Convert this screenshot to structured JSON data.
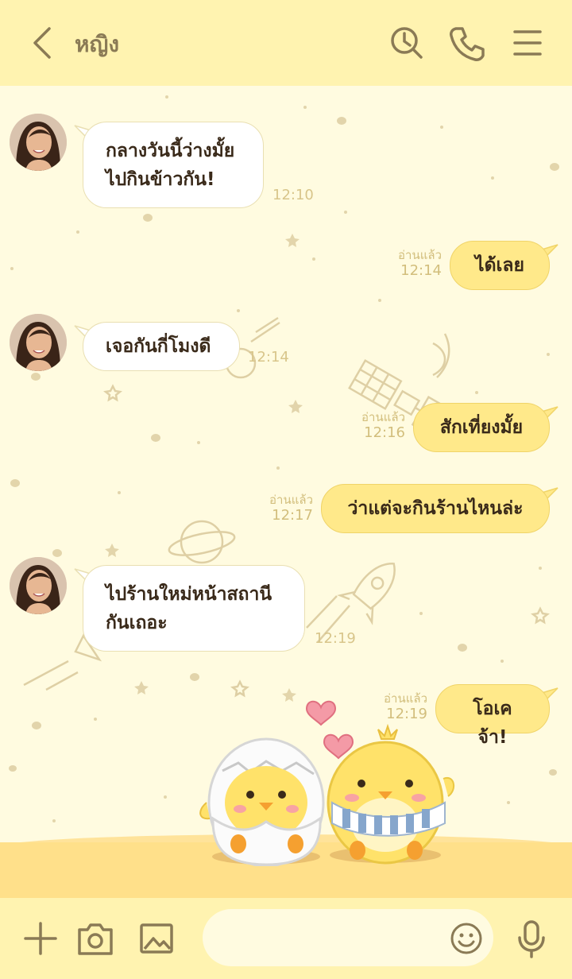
{
  "header": {
    "title": "หญิง",
    "icons": [
      "back-icon",
      "search-history-icon",
      "phone-icon",
      "menu-icon"
    ]
  },
  "messages": [
    {
      "side": "in",
      "lines": [
        "กลางวันนี้ว่างมั้ย",
        "ไปกินข้าวกัน!"
      ],
      "time": "12:10"
    },
    {
      "side": "out",
      "lines": [
        "ได้เลย"
      ],
      "read": "อ่านแล้ว",
      "time": "12:14"
    },
    {
      "side": "in",
      "lines": [
        "เจอกันกี่โมงดี"
      ],
      "time": "12:14"
    },
    {
      "side": "out",
      "lines": [
        "สักเที่ยงมั้ย"
      ],
      "read": "อ่านแล้ว",
      "time": "12:16"
    },
    {
      "side": "out",
      "lines": [
        "ว่าแต่จะกินร้านไหนล่ะ"
      ],
      "read": "อ่านแล้ว",
      "time": "12:17"
    },
    {
      "side": "in",
      "lines": [
        "ไปร้านใหม่หน้าสถานี",
        "กันเถอะ"
      ],
      "time": "12:19"
    },
    {
      "side": "out",
      "lines": [
        "โอเคจ้า!"
      ],
      "read": "อ่านแล้ว",
      "time": "12:19"
    }
  ],
  "footer": {
    "input_value": "",
    "icons": [
      "plus-icon",
      "camera-icon",
      "image-icon",
      "emoji-icon",
      "microphone-icon"
    ]
  },
  "theme": {
    "header_bg": "#fff3b0",
    "chat_bg": "#fffbe0",
    "bubble_out": "#ffe98a",
    "bubble_in": "#ffffff",
    "icon_color": "#8a7a55",
    "ground": "#ffe08a"
  }
}
